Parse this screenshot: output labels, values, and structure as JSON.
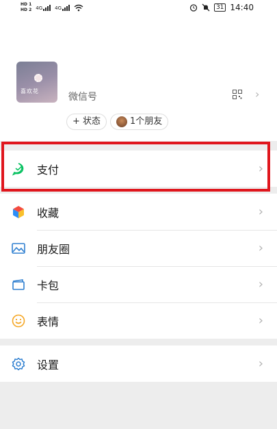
{
  "status_bar": {
    "sim1": "HD 1",
    "sim2": "HD 2",
    "net1": "4G",
    "net2": "4G",
    "battery": "31",
    "time": "14:40"
  },
  "profile": {
    "wechat_id_label": "微信号",
    "status_pill": "+ 状态",
    "friends_pill": "1个朋友",
    "avatar_text": "喜欢花"
  },
  "menu": {
    "pay": "支付",
    "favorites": "收藏",
    "moments": "朋友圈",
    "cards": "卡包",
    "stickers": "表情",
    "settings": "设置"
  },
  "colors": {
    "highlight": "#e0161d",
    "accent_green": "#07c160"
  }
}
